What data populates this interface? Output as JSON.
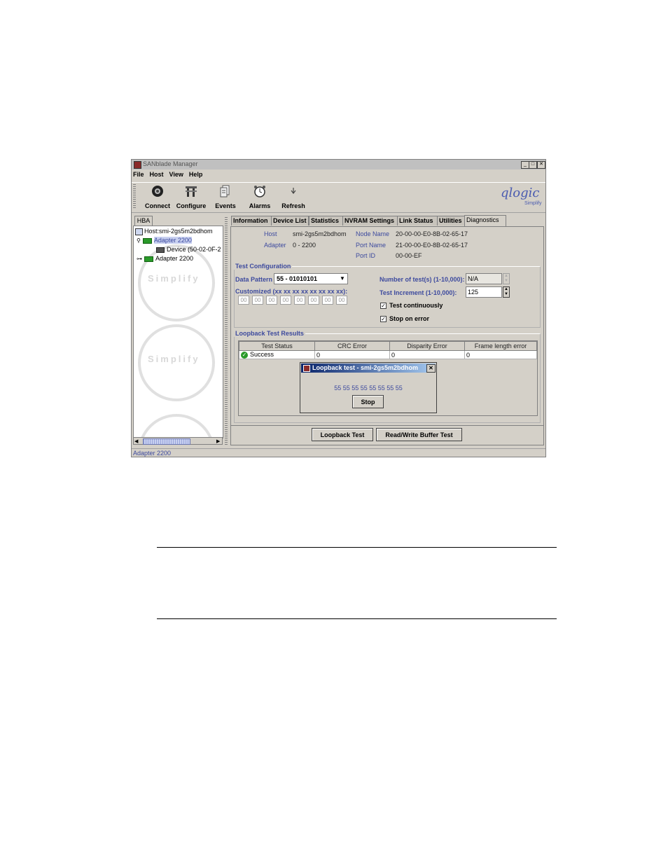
{
  "window": {
    "title": "SANblade Manager",
    "minimize": "_",
    "maximize": "□",
    "close": "✕"
  },
  "menu": [
    "File",
    "Host",
    "View",
    "Help"
  ],
  "toolbar": {
    "items": [
      {
        "label": "Connect",
        "icon": "connect-icon"
      },
      {
        "label": "Configure",
        "icon": "configure-icon"
      },
      {
        "label": "Events",
        "icon": "events-icon"
      },
      {
        "label": "Alarms",
        "icon": "alarms-icon"
      },
      {
        "label": "Refresh",
        "icon": "refresh-icon"
      }
    ],
    "logo_text": "qlogic",
    "logo_sub": "Simplify"
  },
  "left_panel": {
    "tab": "HBA",
    "tree": {
      "host": "Host:smi-2gs5m2bdhom",
      "adapter1": "Adapter 2200",
      "device": "Device (50-02-0F-2",
      "adapter2": "Adapter 2200"
    },
    "watermark": "Simplify"
  },
  "tabs": [
    "Information",
    "Device List",
    "Statistics",
    "NVRAM Settings",
    "Link Status",
    "Utilities",
    "Diagnostics"
  ],
  "info": {
    "host_label": "Host",
    "host_value": "smi-2gs5m2bdhom",
    "adapter_label": "Adapter",
    "adapter_value": "0 - 2200",
    "node_label": "Node Name",
    "node_value": "20-00-00-E0-8B-02-65-17",
    "port_label": "Port Name",
    "port_value": "21-00-00-E0-8B-02-65-17",
    "portid_label": "Port ID",
    "portid_value": "00-00-EF"
  },
  "test_config": {
    "title": "Test Configuration",
    "pattern_label": "Data Pattern",
    "pattern_value": "55 - 01010101",
    "customized_label": "Customized (xx xx xx xx xx xx xx xx):",
    "hex": [
      "00",
      "00",
      "00",
      "00",
      "00",
      "00",
      "00",
      "00"
    ],
    "num_tests_label": "Number of test(s) (1-10,000):",
    "num_tests_value": "N/A",
    "increment_label": "Test Increment (1-10,000):",
    "increment_value": "125",
    "continuous_label": "Test continuously",
    "continuous_checked": true,
    "stop_label": "Stop on error",
    "stop_checked": true
  },
  "results": {
    "title": "Loopback Test Results",
    "columns": [
      "Test Status",
      "CRC Error",
      "Disparity Error",
      "Frame length error"
    ],
    "row": [
      "Success",
      "0",
      "0",
      "0"
    ]
  },
  "dialog": {
    "title": "Loopback test - smi-2gs5m2bdhom",
    "pattern": "55 55 55 55 55 55 55 55",
    "stop": "Stop"
  },
  "buttons": {
    "loopback": "Loopback Test",
    "readwrite": "Read/Write Buffer Test"
  },
  "status": "Adapter 2200",
  "colors": {
    "label": "#3d4a9e",
    "success": "#2a9a2a"
  }
}
